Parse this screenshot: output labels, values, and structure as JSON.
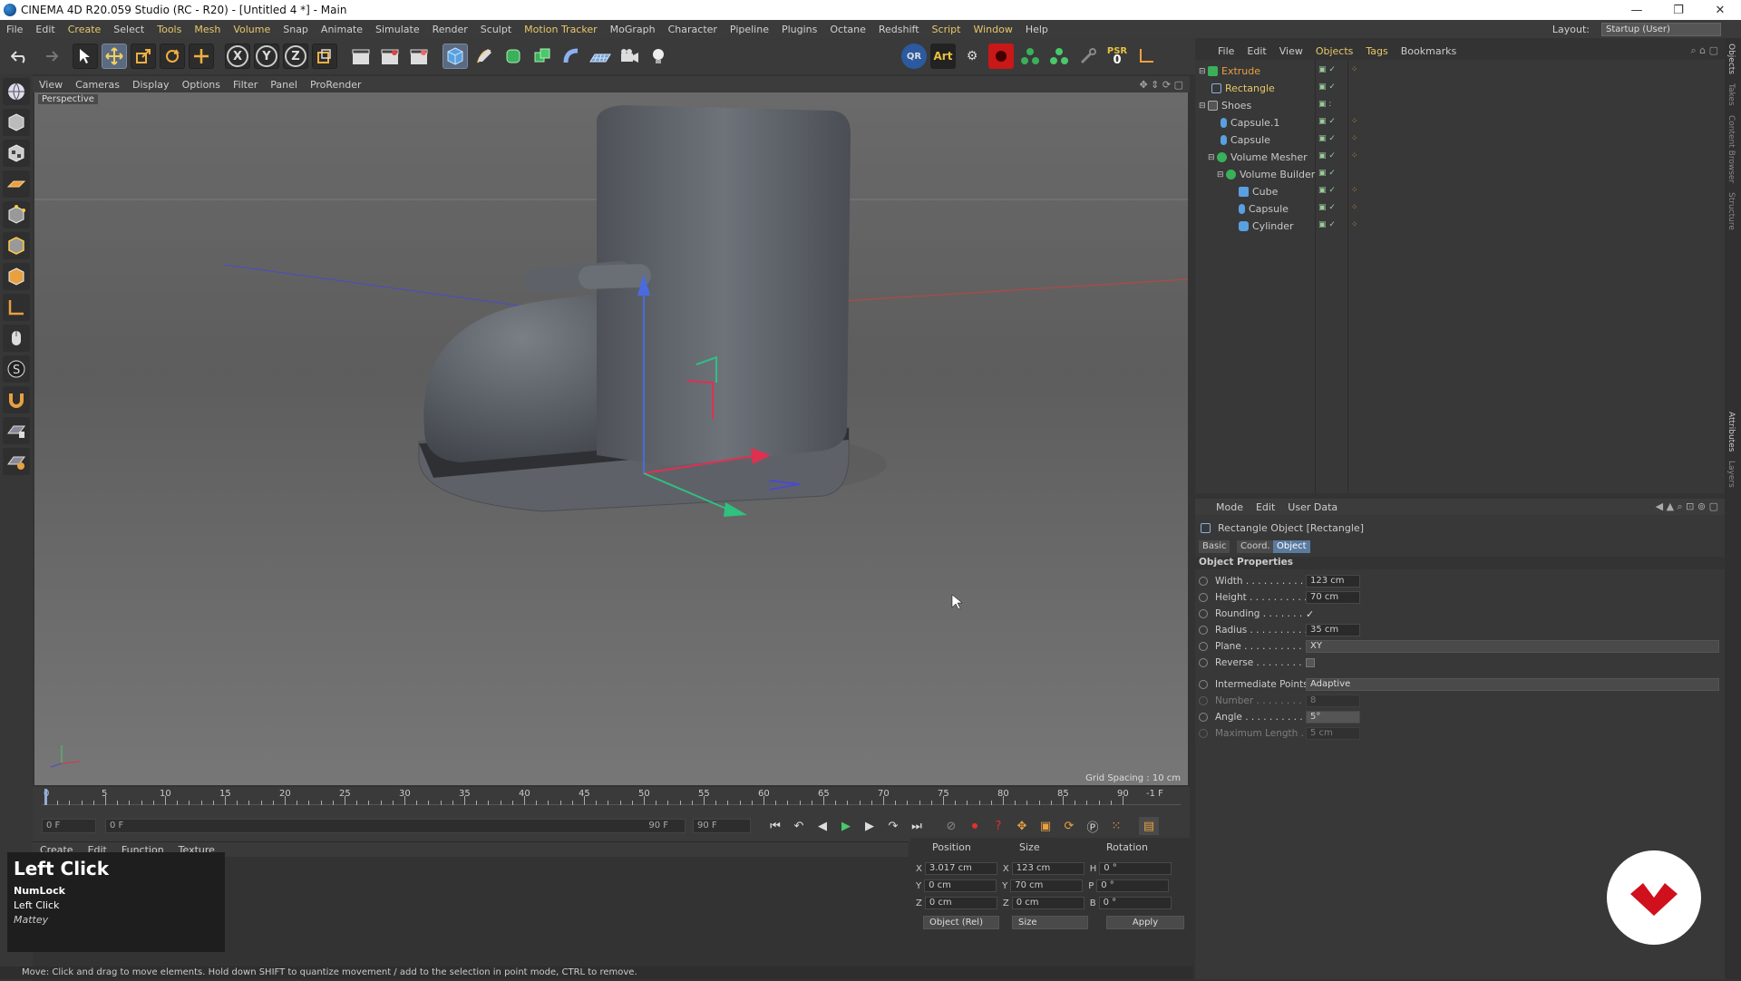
{
  "window": {
    "title": "CINEMA 4D R20.059 Studio (RC - R20) - [Untitled 4 *] - Main"
  },
  "menubar": {
    "items": [
      "File",
      "Edit",
      "Create",
      "Select",
      "Tools",
      "Mesh",
      "Volume",
      "Snap",
      "Animate",
      "Simulate",
      "Render",
      "Sculpt",
      "Motion Tracker",
      "MoGraph",
      "Character",
      "Pipeline",
      "Plugins",
      "Octane",
      "Redshift",
      "Script",
      "Window",
      "Help"
    ],
    "layout_label": "Layout:",
    "layout_value": "Startup (User)"
  },
  "toolbar": {
    "axis_x": "X",
    "axis_y": "Y",
    "axis_z": "Z",
    "psr_label": "PSR",
    "psr_value": "0",
    "qr": "QR",
    "art": "Art"
  },
  "viewport": {
    "menu": [
      "View",
      "Cameras",
      "Display",
      "Options",
      "Filter",
      "Panel",
      "ProRender"
    ],
    "label": "Perspective",
    "grid_spacing": "Grid Spacing : 10 cm"
  },
  "timeline": {
    "ticks": [
      "0",
      "5",
      "10",
      "15",
      "20",
      "25",
      "30",
      "35",
      "40",
      "45",
      "50",
      "55",
      "60",
      "65",
      "70",
      "75",
      "80",
      "85",
      "90"
    ],
    "frame_end_label": "-1 F",
    "current_frame": "0 F",
    "range_start": "0 F",
    "range_end": "90 F",
    "max_frame": "90 F"
  },
  "material_panel": {
    "menu": [
      "Create",
      "Edit",
      "Function",
      "Texture"
    ]
  },
  "coords": {
    "headers": {
      "position": "Position",
      "size": "Size",
      "rotation": "Rotation"
    },
    "rows": [
      {
        "axis": "X",
        "pos": "3.017 cm",
        "saxis": "X",
        "size": "123 cm",
        "raxis": "H",
        "rot": "0 °"
      },
      {
        "axis": "Y",
        "pos": "0 cm",
        "saxis": "Y",
        "size": "70 cm",
        "raxis": "P",
        "rot": "0 °"
      },
      {
        "axis": "Z",
        "pos": "0 cm",
        "saxis": "Z",
        "size": "0 cm",
        "raxis": "B",
        "rot": "0 °"
      }
    ],
    "mode": "Object (Rel)",
    "size_mode": "Size",
    "apply": "Apply"
  },
  "status": "Move: Click and drag to move elements. Hold down SHIFT to quantize movement / add to the selection in point mode, CTRL to remove.",
  "objects": {
    "menu": [
      "File",
      "Edit",
      "View",
      "Objects",
      "Tags",
      "Bookmarks"
    ],
    "items": [
      {
        "name": "Extrude",
        "indent": 0,
        "color": "#e8a040"
      },
      {
        "name": "Rectangle",
        "indent": 1,
        "color": "#e8c86a"
      },
      {
        "name": "Shoes",
        "indent": 0,
        "color": "#c8c8c8"
      },
      {
        "name": "Capsule.1",
        "indent": 1,
        "color": "#c8c8c8"
      },
      {
        "name": "Capsule",
        "indent": 1,
        "color": "#c8c8c8"
      },
      {
        "name": "Volume Mesher",
        "indent": 1,
        "color": "#c8c8c8"
      },
      {
        "name": "Volume Builder",
        "indent": 2,
        "color": "#c8c8c8"
      },
      {
        "name": "Cube",
        "indent": 3,
        "color": "#c8c8c8"
      },
      {
        "name": "Capsule",
        "indent": 3,
        "color": "#c8c8c8"
      },
      {
        "name": "Cylinder",
        "indent": 3,
        "color": "#c8c8c8"
      }
    ]
  },
  "attributes": {
    "menu": [
      "Mode",
      "Edit",
      "User Data"
    ],
    "title": "Rectangle Object [Rectangle]",
    "tabs": [
      "Basic",
      "Coord.",
      "Object"
    ],
    "section": "Object Properties",
    "props": [
      {
        "label": "Width . . . . . . . . . . .",
        "value": "123 cm"
      },
      {
        "label": "Height . . . . . . . . . .",
        "value": "70 cm"
      },
      {
        "label": "Rounding . . . . . . . .",
        "value": "✓"
      },
      {
        "label": "Radius . . . . . . . . . .",
        "value": "35 cm"
      },
      {
        "label": "Plane . . . . . . . . . . .",
        "value": "XY"
      },
      {
        "label": "Reverse . . . . . . . . .",
        "value": ""
      },
      {
        "label": "Intermediate Points",
        "value": "Adaptive"
      },
      {
        "label": "Number . . . . . . . . .",
        "value": "8"
      },
      {
        "label": "Angle . . . . . . . . . . .",
        "value": "5°"
      },
      {
        "label": "Maximum Length . .",
        "value": "5 cm"
      }
    ]
  },
  "right_strip": [
    "Objects",
    "Takes",
    "Content Browser",
    "Structure",
    "Attributes",
    "Layers"
  ],
  "key_overlay": {
    "title": "Left Click",
    "line1": "NumLock",
    "line2": "Left Click",
    "line3": "Mattey"
  }
}
